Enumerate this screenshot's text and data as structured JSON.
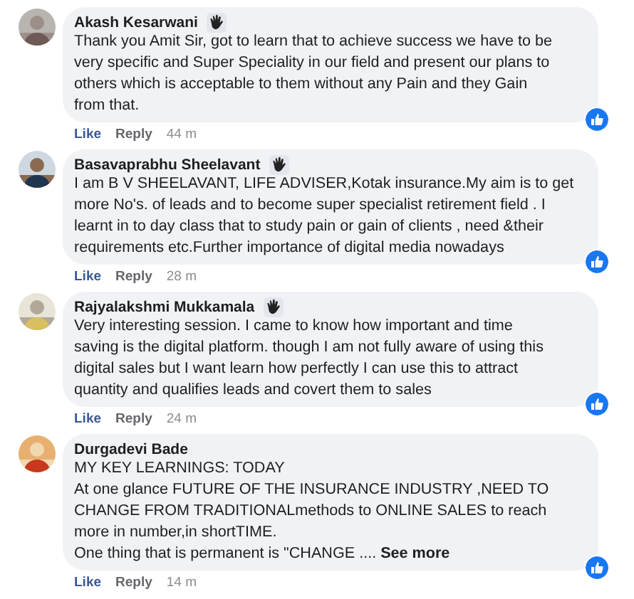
{
  "comments": [
    {
      "author": "Akash Kesarwani",
      "wave_badge": true,
      "body": "Thank you Amit Sir, got to learn that to achieve success we have to be\nvery specific and Super Speciality in our field and present our plans to\nothers which is acceptable to them without any Pain and they Gain\nfrom that.",
      "actions": [
        "Like",
        "Reply"
      ],
      "time": "44 m"
    },
    {
      "author": "Basavaprabhu Sheelavant",
      "wave_badge": true,
      "body": "I am B V SHEELAVANT, LIFE ADVISER,Kotak insurance.My aim is to get\nmore No's. of leads and to become super specialist retirement field . I\nlearnt in to day class that to study pain or gain of clients , need &their\nrequirements etc.Further importance of digital media nowadays",
      "actions": [
        "Like",
        "Reply"
      ],
      "time": "28 m"
    },
    {
      "author": "Rajyalakshmi Mukkamala",
      "wave_badge": true,
      "body": "Very interesting session. I came to know how important and time\nsaving is the digital platform. though I am not fully aware of using this\ndigital sales but I want learn how perfectly I can use this to attract\nquantity and qualifies leads and covert them to sales",
      "actions": [
        "Like",
        "Reply"
      ],
      "time": "24 m"
    },
    {
      "author": "Durgadevi Bade",
      "wave_badge": false,
      "body": "MY KEY LEARNINGS: TODAY\nAt one glance FUTURE OF THE INSURANCE INDUSTRY ,NEED TO\nCHANGE FROM TRADITIONALmethods to ONLINE SALES to reach\nmore in number,in shortTIME.\nOne thing that is permanent is \"CHANGE ....",
      "see_more": "See more",
      "actions": [
        "Like",
        "Reply"
      ],
      "time": "14 m"
    }
  ]
}
